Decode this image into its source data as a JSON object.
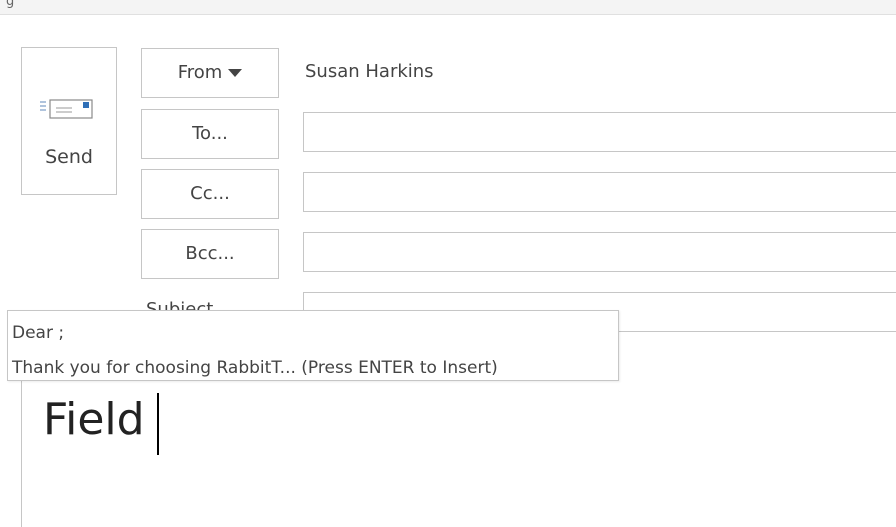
{
  "send": {
    "label": "Send",
    "icon": "send-envelope-icon"
  },
  "header": {
    "from_label": "From",
    "from_caret_icon": "caret-down-icon",
    "from_value": "Susan Harkins",
    "to_label": "To...",
    "cc_label": "Cc...",
    "bcc_label": "Bcc...",
    "subject_label": "Subject"
  },
  "body": {
    "text": "Field"
  },
  "autocomplete": {
    "line1": "Dear ;",
    "line2": "Thank you for choosing RabbitT... (Press ENTER to Insert)"
  },
  "colors": {
    "border": "#c6c6c6",
    "text": "#444444"
  }
}
